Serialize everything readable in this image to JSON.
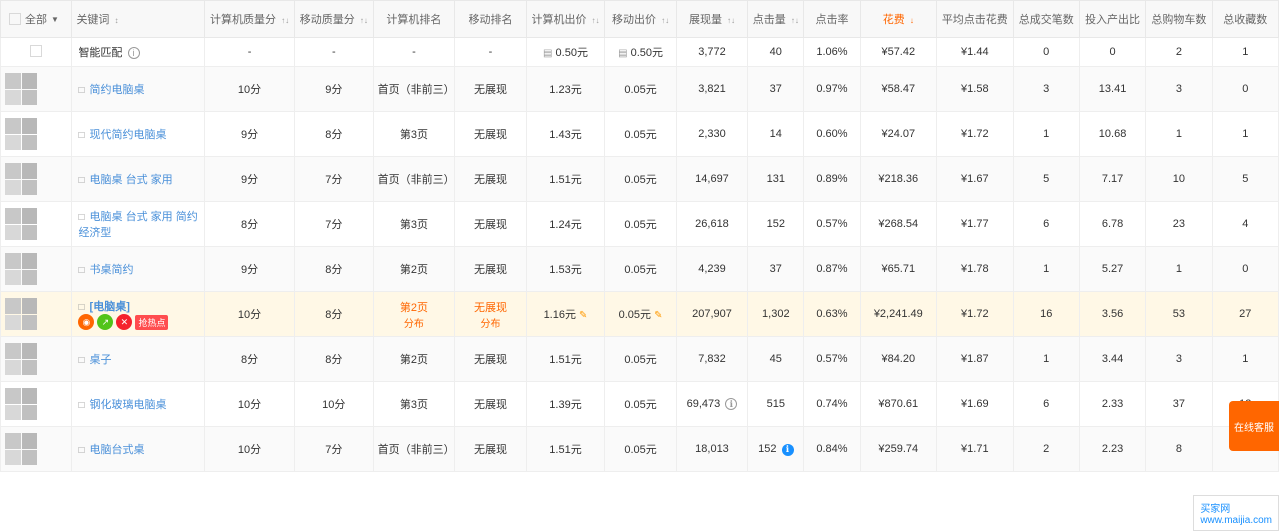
{
  "table": {
    "headers": [
      {
        "id": "select-all",
        "label": "全部",
        "sub": "",
        "sortable": false
      },
      {
        "id": "keyword",
        "label": "关键词",
        "sub": "",
        "sortable": true,
        "icon": "↕"
      },
      {
        "id": "pc-quality",
        "label": "计算机质量分",
        "sub": "",
        "sortable": true
      },
      {
        "id": "mobile-quality",
        "label": "移动质量分",
        "sub": "",
        "sortable": true
      },
      {
        "id": "pc-rank",
        "label": "计算机排名",
        "sub": "",
        "sortable": false
      },
      {
        "id": "mobile-rank",
        "label": "移动排名",
        "sub": "",
        "sortable": false
      },
      {
        "id": "pc-bid",
        "label": "计算机出价",
        "sub": "",
        "sortable": true
      },
      {
        "id": "mobile-bid",
        "label": "移动出价",
        "sub": "",
        "sortable": true
      },
      {
        "id": "impressions",
        "label": "展现量",
        "sub": "",
        "sortable": true
      },
      {
        "id": "clicks",
        "label": "点击量",
        "sub": "",
        "sortable": true
      },
      {
        "id": "ctr",
        "label": "点击率",
        "sub": "",
        "sortable": false
      },
      {
        "id": "cost",
        "label": "花费",
        "sub": "",
        "sortable": false,
        "sorted": true
      },
      {
        "id": "avg-click-cost",
        "label": "平均点击花费",
        "sub": "",
        "sortable": false
      },
      {
        "id": "transactions",
        "label": "总成交笔数",
        "sub": "",
        "sortable": false
      },
      {
        "id": "roi",
        "label": "投入产出比",
        "sub": "",
        "sortable": false
      },
      {
        "id": "cart",
        "label": "总购物车数",
        "sub": "",
        "sortable": false
      },
      {
        "id": "favorites",
        "label": "总收藏数",
        "sub": "",
        "sortable": false
      }
    ],
    "rows": [
      {
        "id": "smart-match",
        "type": "smart",
        "thumbnail": null,
        "keyword": "智能匹配",
        "has_info": true,
        "pc_quality": "-",
        "mobile_quality": "-",
        "pc_rank": "-",
        "mobile_rank": "-",
        "pc_bid": "0.50元",
        "mobile_bid": "0.50元",
        "impressions": "3,772",
        "clicks": "40",
        "ctr": "1.06%",
        "cost": "¥57.42",
        "avg_cost": "¥1.44",
        "transactions": "0",
        "roi": "0",
        "cart": "2",
        "favorites": "1"
      },
      {
        "id": "row1",
        "type": "mobile",
        "keyword": "简约电脑桌",
        "pc_quality": "10分",
        "mobile_quality": "9分",
        "pc_rank": "首页（非前三）",
        "mobile_rank": "无展现",
        "pc_bid": "1.23元",
        "mobile_bid": "0.05元",
        "impressions": "3,821",
        "clicks": "37",
        "ctr": "0.97%",
        "cost": "¥58.47",
        "avg_cost": "¥1.58",
        "transactions": "3",
        "roi": "13.41",
        "cart": "3",
        "favorites": "0"
      },
      {
        "id": "row2",
        "type": "mobile",
        "keyword": "现代简约电脑桌",
        "pc_quality": "9分",
        "mobile_quality": "8分",
        "pc_rank": "第3页",
        "mobile_rank": "无展现",
        "pc_bid": "1.43元",
        "mobile_bid": "0.05元",
        "impressions": "2,330",
        "clicks": "14",
        "ctr": "0.60%",
        "cost": "¥24.07",
        "avg_cost": "¥1.72",
        "transactions": "1",
        "roi": "10.68",
        "cart": "1",
        "favorites": "1"
      },
      {
        "id": "row3",
        "type": "mobile",
        "keyword": "电脑桌 台式 家用",
        "pc_quality": "9分",
        "mobile_quality": "7分",
        "pc_rank": "首页（非前三）",
        "mobile_rank": "无展现",
        "pc_bid": "1.51元",
        "mobile_bid": "0.05元",
        "impressions": "14,697",
        "clicks": "131",
        "ctr": "0.89%",
        "cost": "¥218.36",
        "avg_cost": "¥1.67",
        "transactions": "5",
        "roi": "7.17",
        "cart": "10",
        "favorites": "5"
      },
      {
        "id": "row4",
        "type": "mobile",
        "keyword": "电脑桌 台式 家用 简约 经济型",
        "pc_quality": "8分",
        "mobile_quality": "7分",
        "pc_rank": "第3页",
        "mobile_rank": "无展现",
        "pc_bid": "1.24元",
        "mobile_bid": "0.05元",
        "impressions": "26,618",
        "clicks": "152",
        "ctr": "0.57%",
        "cost": "¥268.54",
        "avg_cost": "¥1.77",
        "transactions": "6",
        "roi": "6.78",
        "cart": "23",
        "favorites": "4"
      },
      {
        "id": "row5",
        "type": "mobile",
        "keyword": "书桌简约",
        "pc_quality": "9分",
        "mobile_quality": "8分",
        "pc_rank": "第2页",
        "mobile_rank": "无展现",
        "pc_bid": "1.53元",
        "mobile_bid": "0.05元",
        "impressions": "4,239",
        "clicks": "37",
        "ctr": "0.87%",
        "cost": "¥65.71",
        "avg_cost": "¥1.78",
        "transactions": "1",
        "roi": "5.27",
        "cart": "1",
        "favorites": "0"
      },
      {
        "id": "row6",
        "type": "mobile_highlight",
        "keyword": "[电脑桌]",
        "pc_quality": "10分",
        "mobile_quality": "8分",
        "pc_rank": "第2页",
        "mobile_rank": "无展现",
        "pc_rank_color": "orange",
        "mobile_rank_color": "orange",
        "pc_rank_suffix": "分布",
        "mobile_rank_suffix": "分布",
        "pc_bid": "1.16元",
        "mobile_bid": "0.05元",
        "impressions": "207,907",
        "clicks": "1,302",
        "ctr": "0.63%",
        "cost": "¥2,241.49",
        "avg_cost": "¥1.72",
        "transactions": "16",
        "roi": "3.56",
        "cart": "53",
        "favorites": "27",
        "has_actions": true
      },
      {
        "id": "row7",
        "type": "mobile",
        "keyword": "桌子",
        "pc_quality": "8分",
        "mobile_quality": "8分",
        "pc_rank": "第2页",
        "mobile_rank": "无展现",
        "pc_bid": "1.51元",
        "mobile_bid": "0.05元",
        "impressions": "7,832",
        "clicks": "45",
        "ctr": "0.57%",
        "cost": "¥84.20",
        "avg_cost": "¥1.87",
        "transactions": "1",
        "roi": "3.44",
        "cart": "3",
        "favorites": "1"
      },
      {
        "id": "row8",
        "type": "mobile",
        "keyword": "钢化玻璃电脑桌",
        "pc_quality": "10分",
        "mobile_quality": "10分",
        "pc_rank": "第3页",
        "mobile_rank": "无展现",
        "pc_bid": "1.39元",
        "mobile_bid": "0.05元",
        "impressions": "69,473",
        "clicks": "515",
        "ctr": "0.74%",
        "cost": "¥870.61",
        "avg_cost": "¥1.69",
        "transactions": "6",
        "roi": "2.33",
        "cart": "37",
        "favorites": "12",
        "has_info_impressions": true
      },
      {
        "id": "row9",
        "type": "mobile",
        "keyword": "电脑台式桌",
        "pc_quality": "10分",
        "mobile_quality": "7分",
        "pc_rank": "首页（非前三）",
        "mobile_rank": "无展现",
        "pc_bid": "1.51元",
        "mobile_bid": "0.05元",
        "impressions": "18,013",
        "clicks": "152",
        "ctr": "0.84%",
        "cost": "¥259.74",
        "avg_cost": "¥1.71",
        "transactions": "2",
        "roi": "2.23",
        "cart": "8",
        "favorites": ""
      }
    ]
  },
  "ui": {
    "online_service": "在线客服",
    "maijia_label": "买家网",
    "maijia_url": "www.maijia.com"
  }
}
